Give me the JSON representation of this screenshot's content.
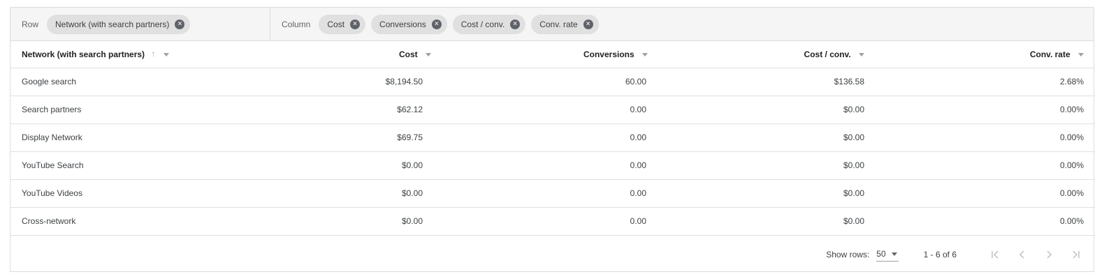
{
  "pivot": {
    "row_label": "Row",
    "row_chips": [
      "Network (with search partners)"
    ],
    "column_label": "Column",
    "column_chips": [
      "Cost",
      "Conversions",
      "Cost / conv.",
      "Conv. rate"
    ]
  },
  "table": {
    "columns": [
      "Network (with search partners)",
      "Cost",
      "Conversions",
      "Cost / conv.",
      "Conv. rate"
    ],
    "sort_indicator": "↑",
    "rows": [
      [
        "Google search",
        "$8,194.50",
        "60.00",
        "$136.58",
        "2.68%"
      ],
      [
        "Search partners",
        "$62.12",
        "0.00",
        "$0.00",
        "0.00%"
      ],
      [
        "Display Network",
        "$69.75",
        "0.00",
        "$0.00",
        "0.00%"
      ],
      [
        "YouTube Search",
        "$0.00",
        "0.00",
        "$0.00",
        "0.00%"
      ],
      [
        "YouTube Videos",
        "$0.00",
        "0.00",
        "$0.00",
        "0.00%"
      ],
      [
        "Cross-network",
        "$0.00",
        "0.00",
        "$0.00",
        "0.00%"
      ]
    ]
  },
  "footer": {
    "show_rows_label": "Show rows:",
    "rows_value": "50",
    "range": "1 - 6 of 6"
  },
  "icons": {
    "chip_remove": "close-circle-icon",
    "sort": "arrow-up-icon",
    "dropdown": "caret-down-icon",
    "first_page": "first-page-icon",
    "prev_page": "chevron-left-icon",
    "next_page": "chevron-right-icon",
    "last_page": "last-page-icon"
  },
  "colors": {
    "pivot_bg": "#f5f5f5",
    "chip_bg": "#e0e0e0",
    "border": "#dadce0"
  }
}
